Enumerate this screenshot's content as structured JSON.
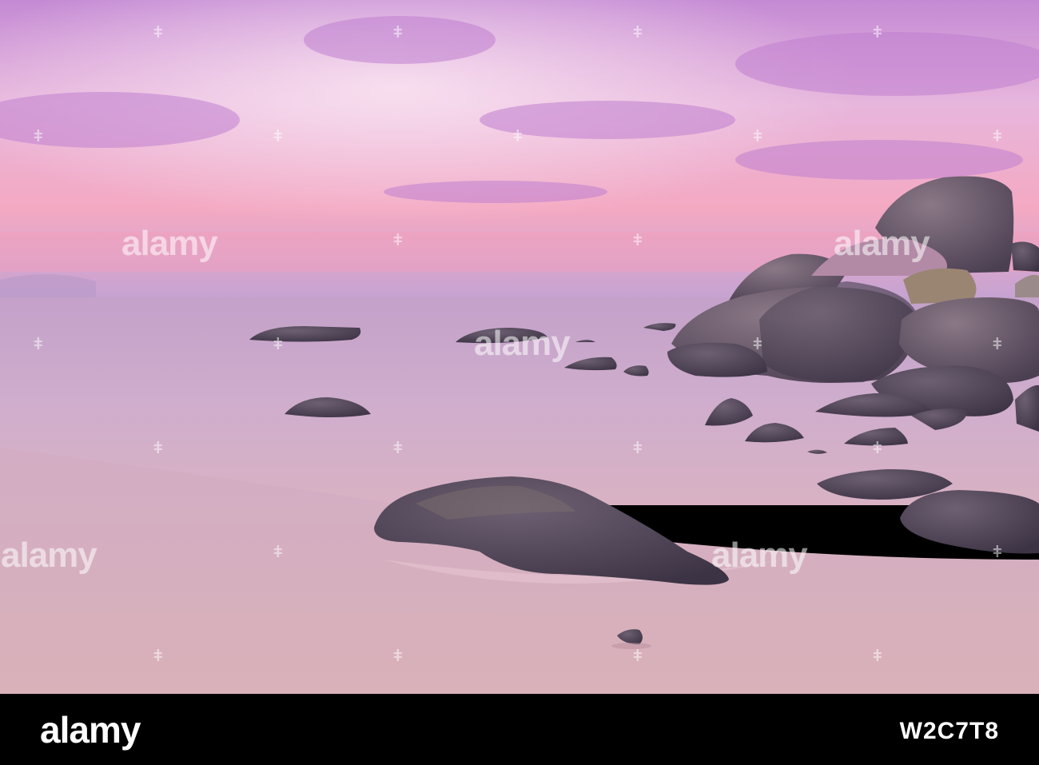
{
  "watermark": {
    "brand": "alamy",
    "dot_glyph": "ǂ"
  },
  "footer": {
    "brand": "alamy",
    "image_id": "W2C7T8"
  },
  "colors": {
    "sky_top": "#c98fd6",
    "sky_glow": "#f2b0c6",
    "horizon_pink": "#f5a6bd",
    "sea": "#c9a3c8",
    "sand": "#d9b3c0",
    "rock": "#5a4c5e",
    "footer_bg": "#000000"
  }
}
